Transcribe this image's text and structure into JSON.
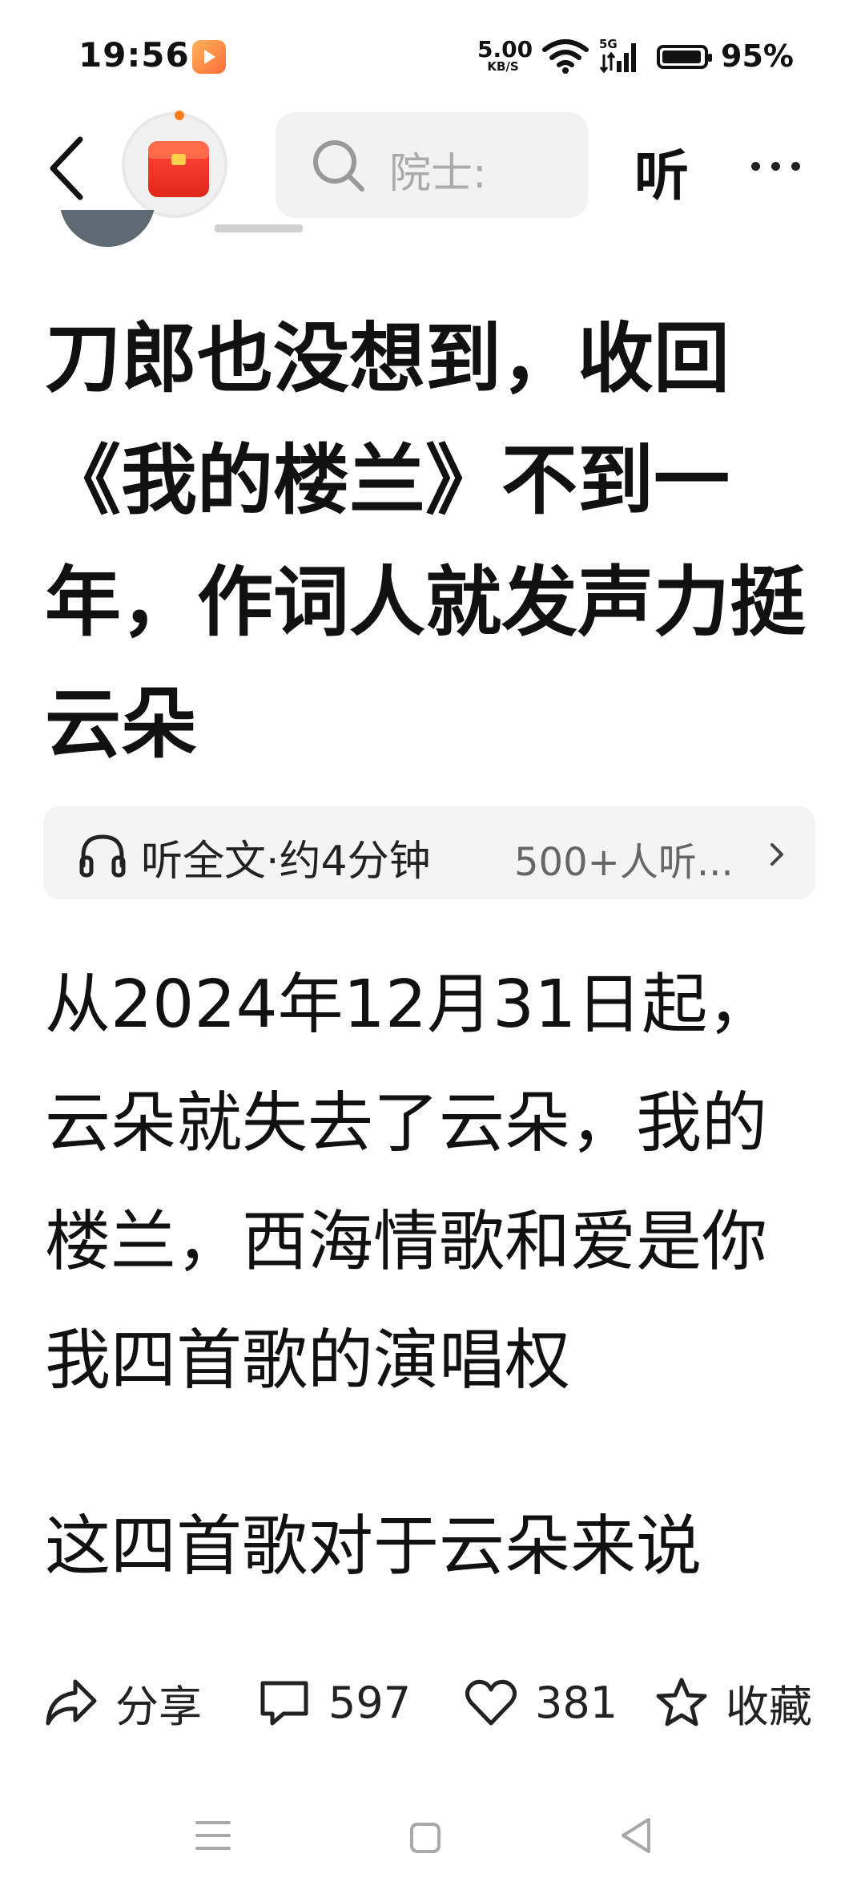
{
  "status_bar": {
    "time": "19:56",
    "net_speed_value": "5.00",
    "net_speed_unit": "KB/S",
    "network_type": "5G",
    "battery_percent": "95%",
    "battery_level": 0.95,
    "icons": [
      "video-app-icon",
      "wifi-icon",
      "signal-icon",
      "battery-icon"
    ]
  },
  "nav": {
    "search_placeholder": "院士:",
    "listen_label": "听",
    "icons": [
      "back-arrow-icon",
      "red-packet-icon",
      "search-icon",
      "more-icon"
    ]
  },
  "article": {
    "title": "刀郎也没想到，收回《我的楼兰》不到一年，作词人就发声力挺云朵",
    "listen_text": "听全文·约4分钟",
    "listen_count": "500+人听...",
    "paragraphs": [
      "从2024年12月31日起，云朵就失去了云朵，我的楼兰，西海情歌和爱是你我四首歌的演唱权",
      "这四首歌对于云朵来说"
    ]
  },
  "actions": {
    "share_label": "分享",
    "comment_count": "597",
    "like_count": "381",
    "favorite_label": "收藏"
  },
  "colors": {
    "background": "#ffffff",
    "text": "#111111",
    "accent_red": "#e1261a",
    "app_badge": "#ff8a3a",
    "muted": "#666666"
  }
}
